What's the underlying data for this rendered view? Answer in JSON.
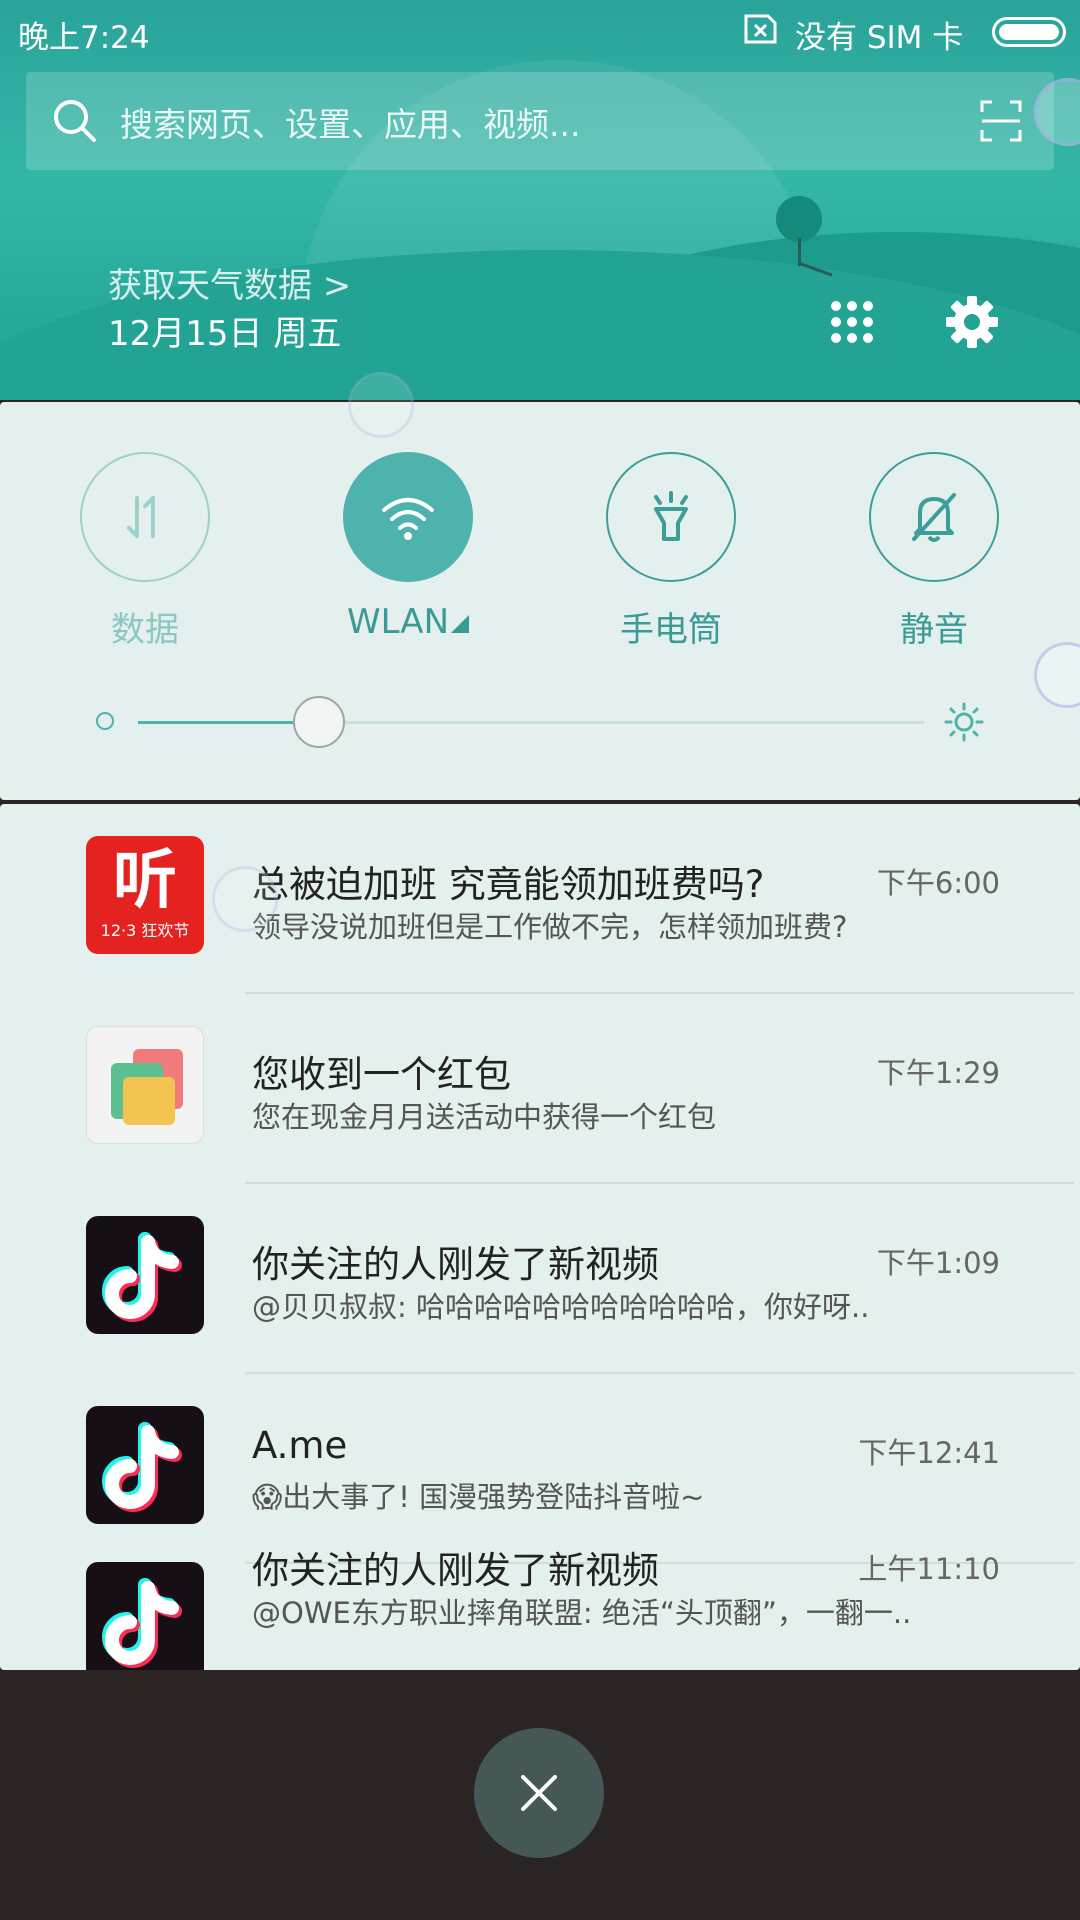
{
  "status_bar": {
    "time": "晚上7:24",
    "sim_status": "没有 SIM 卡",
    "sim_icon": "no-sim-icon",
    "battery_icon": "battery-icon"
  },
  "search": {
    "placeholder": "搜索网页、设置、应用、视频...",
    "icon": "search-icon",
    "scan_icon": "scan-icon"
  },
  "weather": {
    "link": "获取天气数据 >",
    "date": "12月15日 周五"
  },
  "quick_toggles": [
    {
      "label": "数据",
      "icon": "mobile-data-icon",
      "on": false
    },
    {
      "label": "WLAN",
      "icon": "wifi-icon",
      "on": true
    },
    {
      "label": "手电筒",
      "icon": "flashlight-icon",
      "on": false
    },
    {
      "label": "静音",
      "icon": "mute-bell-icon",
      "on": false
    }
  ],
  "brightness": {
    "level": 0.23
  },
  "notifications": [
    {
      "app_icon": "ting-app-icon",
      "icon_text_big": "听",
      "icon_text_small": "12·3 狂欢节",
      "title": "总被迫加班 究竟能领加班费吗?",
      "time": "下午6:00",
      "body": "领导没说加班但是工作做不完，怎样领加班费?"
    },
    {
      "app_icon": "red-envelope-app-icon",
      "title": "您收到一个红包",
      "time": "下午1:29",
      "body": "您在现金月月送活动中获得一个红包"
    },
    {
      "app_icon": "tiktok-app-icon",
      "title": "你关注的人刚发了新视频",
      "time": "下午1:09",
      "body": "@贝贝叔叔: 哈哈哈哈哈哈哈哈哈哈哈，你好呀.."
    },
    {
      "app_icon": "tiktok-app-icon",
      "title": "A.me",
      "time": "下午12:41",
      "body": "😱出大事了! 国漫强势登陆抖音啦~"
    },
    {
      "app_icon": "tiktok-app-icon",
      "title": "你关注的人刚发了新视频",
      "time": "上午11:10",
      "body": "@OWE东方职业摔角联盟: 绝活“头顶翻”，一翻一.."
    }
  ],
  "close_button": {
    "icon": "close-icon",
    "label": "×"
  }
}
